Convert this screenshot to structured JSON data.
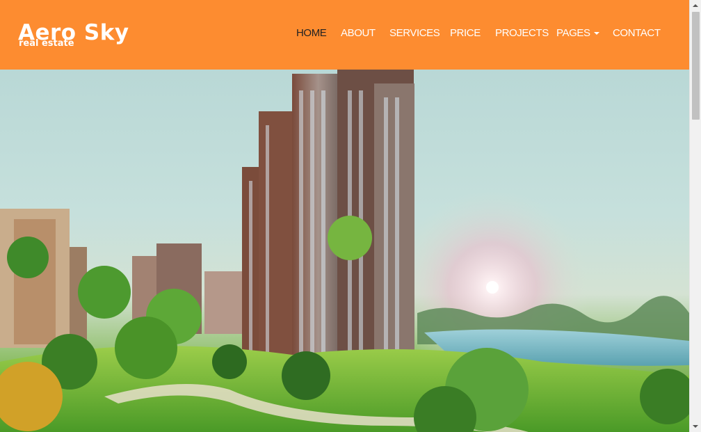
{
  "brand": {
    "name": "Aero Sky",
    "tagline": "real estate"
  },
  "nav": {
    "items": [
      {
        "label": "HOME",
        "active": true
      },
      {
        "label": "ABOUT"
      },
      {
        "label": "SERVICES"
      },
      {
        "label": "PRICE"
      },
      {
        "label": "PROJECTS"
      },
      {
        "label": "PAGES",
        "dropdown": true
      },
      {
        "label": "CONTACT"
      }
    ]
  },
  "colors": {
    "navbar": "#fd8c30",
    "active_link": "#222222",
    "link": "#ffffff"
  },
  "hero": {
    "image": "apartment-towers-landscape-image"
  }
}
